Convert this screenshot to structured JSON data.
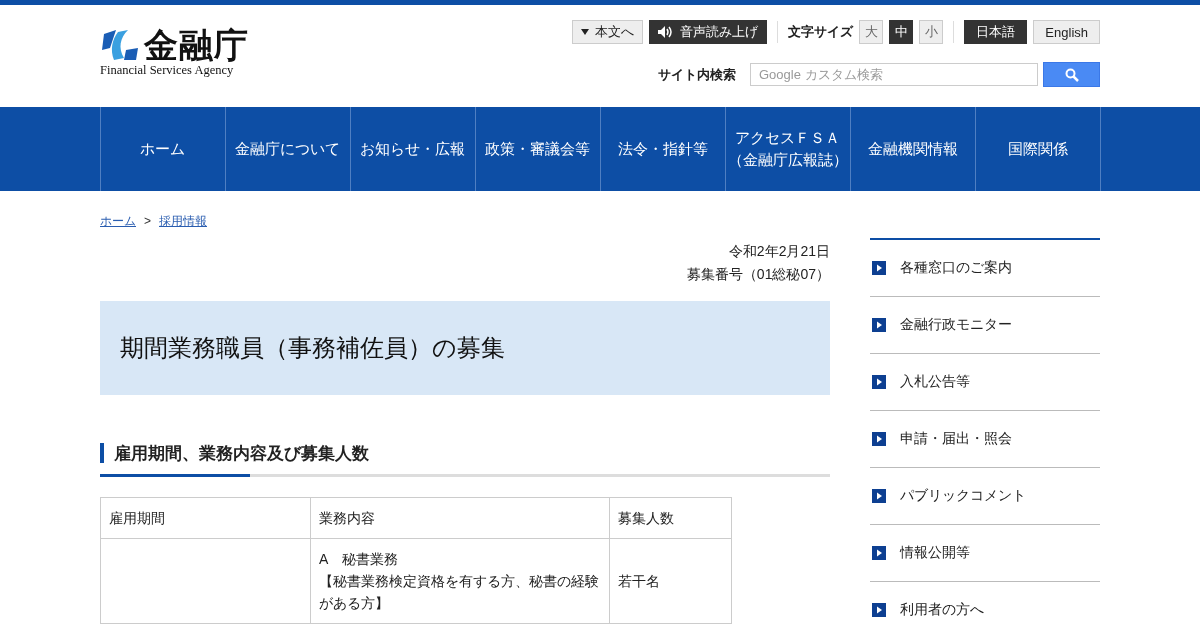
{
  "logo": {
    "name": "金融庁",
    "subtitle": "Financial Services Agency"
  },
  "utility": {
    "skip_link": "本文へ",
    "read_aloud": "音声読み上げ",
    "font_size_label": "文字サイズ",
    "font_sizes": [
      {
        "label": "大",
        "selected": false
      },
      {
        "label": "中",
        "selected": true
      },
      {
        "label": "小",
        "selected": false
      }
    ],
    "languages": [
      {
        "label": "日本語",
        "selected": true
      },
      {
        "label": "English",
        "selected": false
      }
    ]
  },
  "search": {
    "label": "サイト内検索",
    "placeholder": "Google カスタム検索"
  },
  "nav": [
    {
      "label": "ホーム"
    },
    {
      "label": "金融庁について"
    },
    {
      "label": "お知らせ・広報"
    },
    {
      "label": "政策・審議会等"
    },
    {
      "label": "法令・指針等"
    },
    {
      "label": "アクセスＦＳＡ",
      "sublabel": "（金融庁広報誌）"
    },
    {
      "label": "金融機関情報"
    },
    {
      "label": "国際関係"
    }
  ],
  "breadcrumb": {
    "separator": ">",
    "items": [
      "ホーム",
      "採用情報"
    ]
  },
  "date": "令和2年2月21日",
  "recruit_number": "募集番号（01総秘07）",
  "title": "期間業務職員（事務補佐員）の募集",
  "section_heading": "雇用期間、業務内容及び募集人数",
  "table": {
    "columns": [
      "雇用期間",
      "業務内容",
      "募集人数"
    ],
    "rows": [
      {
        "cells": [
          [],
          [
            "A　秘書業務",
            "【秘書業務検定資格を有する方、秘書の経験がある方】"
          ],
          [
            "若干名"
          ]
        ]
      }
    ]
  },
  "sidebar": {
    "items": [
      "各種窓口のご案内",
      "金融行政モニター",
      "入札公告等",
      "申請・届出・照会",
      "パブリックコメント",
      "情報公開等",
      "利用者の方へ"
    ]
  }
}
